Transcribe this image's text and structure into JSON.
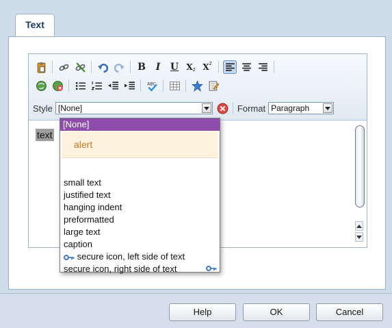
{
  "tabs": [
    {
      "label": "Text"
    }
  ],
  "style": {
    "label": "Style",
    "selected": "[None]",
    "options": {
      "none": "[None]",
      "alert": "alert",
      "small_text": "small text",
      "justified_text": "justified text",
      "hanging_indent": "hanging indent",
      "preformatted": "preformatted",
      "large_text": "large text",
      "caption": "caption",
      "secure_left": "secure icon, left side of text",
      "secure_right": "secure icon, right side of text"
    }
  },
  "format": {
    "label": "Format",
    "selected": "Paragraph"
  },
  "toolbar": {
    "bold": "B",
    "italic": "I",
    "underline": "U",
    "subscript": "X",
    "superscript": "X"
  },
  "editor": {
    "text": "text"
  },
  "buttons": {
    "help": "Help",
    "ok": "OK",
    "cancel": "Cancel"
  },
  "colors": {
    "dropdown_selected": "#8e4dab",
    "alert_bg": "#fdf2de",
    "alert_text": "#c0782a"
  }
}
